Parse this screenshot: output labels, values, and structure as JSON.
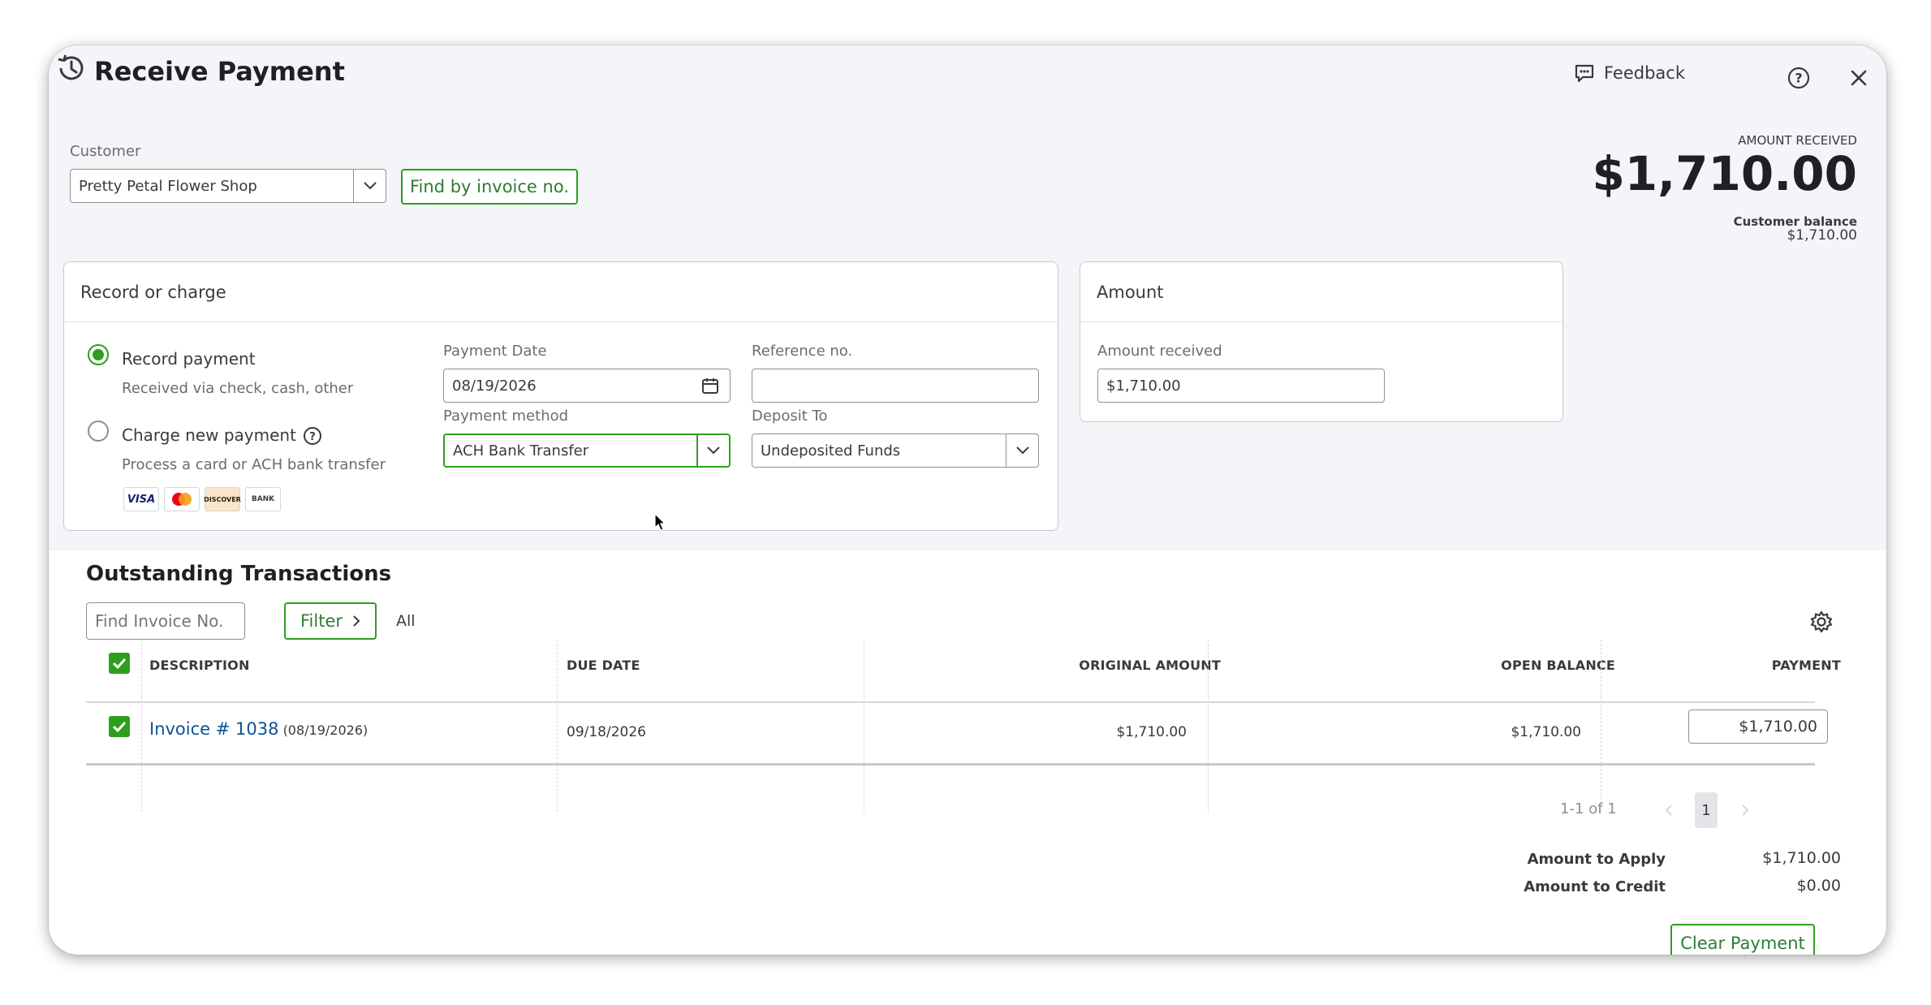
{
  "window": {
    "title": "Receive Payment",
    "feedback_label": "Feedback"
  },
  "customer": {
    "label": "Customer",
    "value": "Pretty Petal Flower Shop",
    "find_invoice_label": "Find by invoice no."
  },
  "summary": {
    "amount_received_label": "AMOUNT RECEIVED",
    "amount_received_value": "$1,710.00",
    "customer_balance_label": "Customer balance",
    "customer_balance_value": "$1,710.00"
  },
  "record_card": {
    "title": "Record or charge",
    "record_payment": {
      "label": "Record payment",
      "sublabel": "Received via check, cash, other",
      "selected": true
    },
    "charge_payment": {
      "label": "Charge new payment",
      "sublabel": "Process a card or ACH bank transfer",
      "selected": false
    },
    "card_logos": [
      "VISA",
      "Mastercard",
      "DISCOVER",
      "BANK"
    ],
    "payment_date": {
      "label": "Payment Date",
      "value": "08/19/2026"
    },
    "reference": {
      "label": "Reference no.",
      "value": ""
    },
    "payment_method": {
      "label": "Payment method",
      "value": "ACH Bank Transfer"
    },
    "deposit_to": {
      "label": "Deposit To",
      "value": "Undeposited Funds"
    }
  },
  "amount_card": {
    "title": "Amount",
    "amount_received_label": "Amount received",
    "amount_received_value": "$1,710.00"
  },
  "outstanding": {
    "title": "Outstanding Transactions",
    "search_placeholder": "Find Invoice No.",
    "filter_label": "Filter",
    "filter_value": "All",
    "columns": {
      "description": "DESCRIPTION",
      "due_date": "DUE DATE",
      "original_amount": "ORIGINAL AMOUNT",
      "open_balance": "OPEN BALANCE",
      "payment": "PAYMENT"
    },
    "rows": [
      {
        "invoice": "Invoice # 1038",
        "invoice_date": "(08/19/2026)",
        "due_date": "09/18/2026",
        "original_amount": "$1,710.00",
        "open_balance": "$1,710.00",
        "payment": "$1,710.00",
        "checked": true
      }
    ],
    "pagination": {
      "range": "1-1 of 1",
      "page": "1"
    }
  },
  "totals": {
    "apply_label": "Amount to Apply",
    "apply_value": "$1,710.00",
    "credit_label": "Amount to Credit",
    "credit_value": "$0.00"
  },
  "clear_payment_label": "Clear Payment",
  "colors": {
    "accent_green": "#2ca01c",
    "link_blue": "#0b5394",
    "panel_bg": "#f4f5f8"
  }
}
